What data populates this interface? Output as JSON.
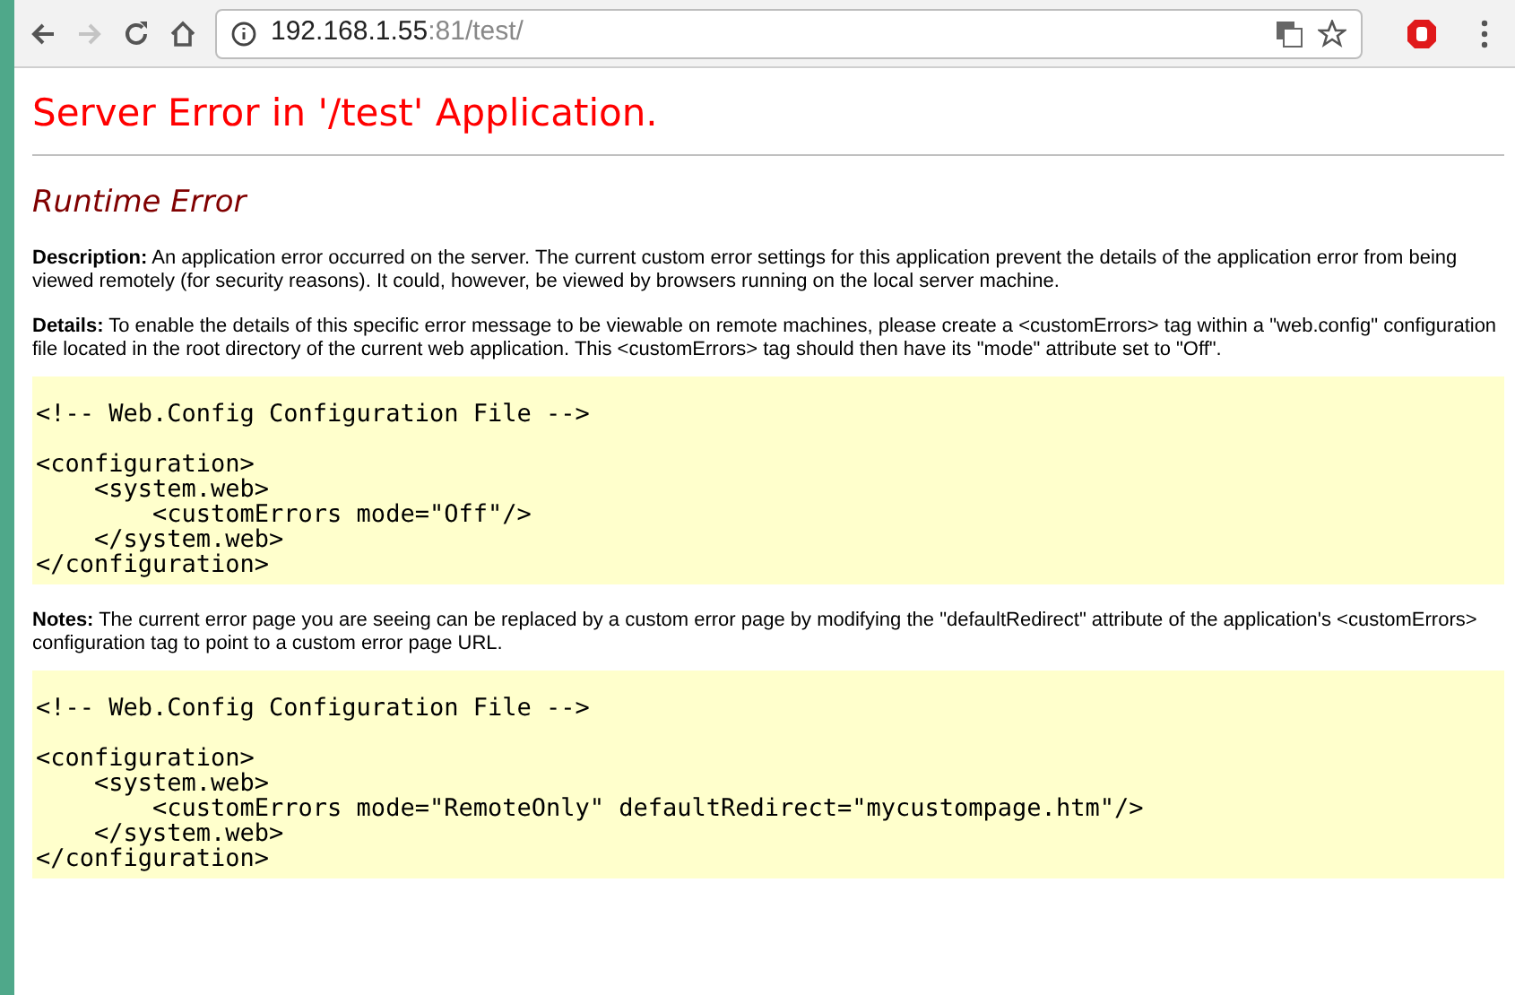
{
  "browser": {
    "url_host": "192.168.1.55",
    "url_rest": ":81/test/"
  },
  "page": {
    "title": "Server Error in '/test' Application.",
    "subtitle": "Runtime Error",
    "paragraphs": [
      {
        "kind": "text",
        "text": "**Description:** An application error occurred on the server. The current custom error settings for this application prevent the details of the application error from being viewed remotely (for security reasons). It could, however, be viewed by browsers running on the local server machine."
      },
      {
        "kind": "text",
        "text": "**Details:** To enable the details of this specific error message to be viewable on remote machines, please create a <customErrors> tag within a \"web.config\" configuration file located in the root directory of the current web application. This <customErrors> tag should then have its \"mode\" attribute set to \"Off\"."
      },
      {
        "kind": "code",
        "comment": "<!-- Web.Config Configuration File -->",
        "lines": [
          "<configuration>",
          "    <system.web>",
          "        <customErrors mode=\"Off\"/>",
          "    </system.web>",
          "</configuration>"
        ]
      },
      {
        "kind": "text",
        "text": "**Notes:** The current error page you are seeing can be replaced by a custom error page by modifying the \"defaultRedirect\" attribute of the application's <customErrors> configuration tag to point to a custom error page URL."
      },
      {
        "kind": "code",
        "comment": "<!-- Web.Config Configuration File -->",
        "lines": [
          "<configuration>",
          "    <system.web>",
          "        <customErrors mode=\"RemoteOnly\" defaultRedirect=\"mycustompage.htm\"/>",
          "    </system.web>",
          "</configuration>"
        ]
      }
    ]
  }
}
